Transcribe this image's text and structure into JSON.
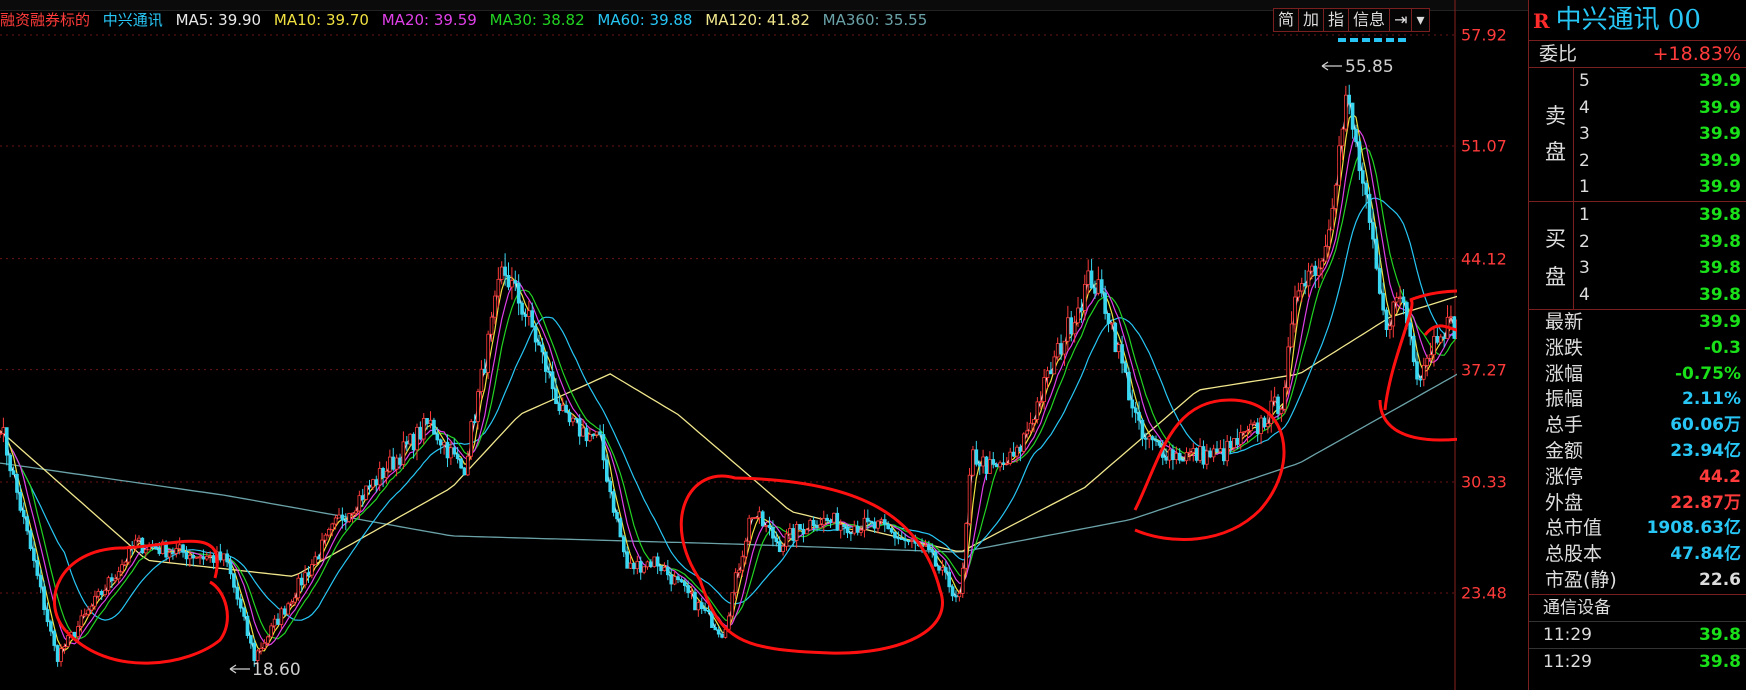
{
  "ma_bar": {
    "label": "融资融券标的",
    "stock": "中兴通讯",
    "items": [
      {
        "text": "MA5: 39.90",
        "color": "#e8e8e8"
      },
      {
        "text": "MA10: 39.70",
        "color": "#f0e040"
      },
      {
        "text": "MA20: 39.59",
        "color": "#e040e8"
      },
      {
        "text": "MA30: 38.82",
        "color": "#22d322"
      },
      {
        "text": "MA60: 39.88",
        "color": "#27c6f5"
      },
      {
        "text": "MA120: 41.82",
        "color": "#f0e68c"
      },
      {
        "text": "MA360: 35.55",
        "color": "#6aa2a8"
      }
    ]
  },
  "toolbar": {
    "simple": "简",
    "add": "加",
    "index": "指",
    "info": "信息",
    "jump": "⇥",
    "more": "▾"
  },
  "price_axis": [
    {
      "label": "57.92",
      "value": 57.92
    },
    {
      "label": "51.07",
      "value": 51.07
    },
    {
      "label": "44.12",
      "value": 44.12
    },
    {
      "label": "37.27",
      "value": 37.27
    },
    {
      "label": "30.33",
      "value": 30.33
    },
    {
      "label": "23.48",
      "value": 23.48
    }
  ],
  "annotations": {
    "high": "55.85",
    "low": "18.60"
  },
  "chart_data": {
    "type": "line",
    "close_anchors": [
      [
        0,
        34
      ],
      [
        50,
        19.5
      ],
      [
        120,
        26.5
      ],
      [
        200,
        25.5
      ],
      [
        225,
        19.5
      ],
      [
        300,
        28
      ],
      [
        380,
        34
      ],
      [
        410,
        31
      ],
      [
        445,
        43.5
      ],
      [
        470,
        40
      ],
      [
        500,
        34
      ],
      [
        530,
        33
      ],
      [
        555,
        25
      ],
      [
        580,
        25.5
      ],
      [
        600,
        24
      ],
      [
        640,
        21
      ],
      [
        665,
        28.5
      ],
      [
        690,
        26.5
      ],
      [
        720,
        28
      ],
      [
        780,
        27.5
      ],
      [
        820,
        26
      ],
      [
        850,
        23
      ],
      [
        860,
        32
      ],
      [
        880,
        31
      ],
      [
        900,
        32
      ],
      [
        940,
        39
      ],
      [
        965,
        43
      ],
      [
        980,
        41
      ],
      [
        1010,
        33
      ],
      [
        1040,
        32
      ],
      [
        1080,
        32
      ],
      [
        1110,
        33.5
      ],
      [
        1135,
        35.5
      ],
      [
        1150,
        43
      ],
      [
        1170,
        44
      ],
      [
        1192,
        54
      ],
      [
        1205,
        49
      ],
      [
        1225,
        40
      ],
      [
        1240,
        42
      ],
      [
        1255,
        37
      ],
      [
        1275,
        40
      ],
      [
        1290,
        39.9
      ]
    ],
    "ma_series": [
      {
        "name": "MA360",
        "anchors": [
          [
            0,
            31.5
          ],
          [
            200,
            29.5
          ],
          [
            400,
            27
          ],
          [
            650,
            26.5
          ],
          [
            850,
            26
          ],
          [
            1000,
            28
          ],
          [
            1150,
            31.5
          ],
          [
            1290,
            37
          ]
        ]
      },
      {
        "name": "MA120",
        "anchors": [
          [
            0,
            33.5
          ],
          [
            130,
            25.5
          ],
          [
            260,
            24.5
          ],
          [
            400,
            30
          ],
          [
            460,
            34.5
          ],
          [
            540,
            37
          ],
          [
            600,
            34.5
          ],
          [
            700,
            28.5
          ],
          [
            850,
            26
          ],
          [
            960,
            30
          ],
          [
            1060,
            36
          ],
          [
            1150,
            37
          ],
          [
            1230,
            40.5
          ],
          [
            1290,
            41.8
          ]
        ]
      }
    ]
  },
  "sidebar": {
    "mark": "R",
    "title": "中兴通讯 00",
    "weibi_label": "委比",
    "weibi_value": "+18.83%",
    "sell_label": "卖盘",
    "buy_label": "买盘",
    "sell_levels": [
      {
        "level": "5",
        "price": "39.9"
      },
      {
        "level": "4",
        "price": "39.9"
      },
      {
        "level": "3",
        "price": "39.9"
      },
      {
        "level": "2",
        "price": "39.9"
      },
      {
        "level": "1",
        "price": "39.9"
      }
    ],
    "buy_levels": [
      {
        "level": "1",
        "price": "39.8"
      },
      {
        "level": "2",
        "price": "39.8"
      },
      {
        "level": "3",
        "price": "39.8"
      },
      {
        "level": "4",
        "price": "39.8"
      }
    ],
    "stats": [
      {
        "label": "最新",
        "value": "39.9",
        "color": "green"
      },
      {
        "label": "涨跌",
        "value": "-0.3",
        "color": "green"
      },
      {
        "label": "涨幅",
        "value": "-0.75%",
        "color": "green"
      },
      {
        "label": "振幅",
        "value": "2.11%",
        "color": "cyan"
      },
      {
        "label": "总手",
        "value": "60.06万",
        "color": "cyan"
      },
      {
        "label": "金额",
        "value": "23.94亿",
        "color": "cyan"
      },
      {
        "label": "涨停",
        "value": "44.2",
        "color": "red"
      },
      {
        "label": "外盘",
        "value": "22.87万",
        "color": "red"
      },
      {
        "label": "总市值",
        "value": "1908.63亿",
        "color": "cyan"
      },
      {
        "label": "总股本",
        "value": "47.84亿",
        "color": "cyan"
      },
      {
        "label": "市盈(静)",
        "value": "22.6",
        "color": "white"
      }
    ],
    "sector": "通信设备",
    "ticks": [
      {
        "time": "11:29",
        "price": "39.8"
      },
      {
        "time": "11:29",
        "price": "39.8"
      }
    ]
  }
}
